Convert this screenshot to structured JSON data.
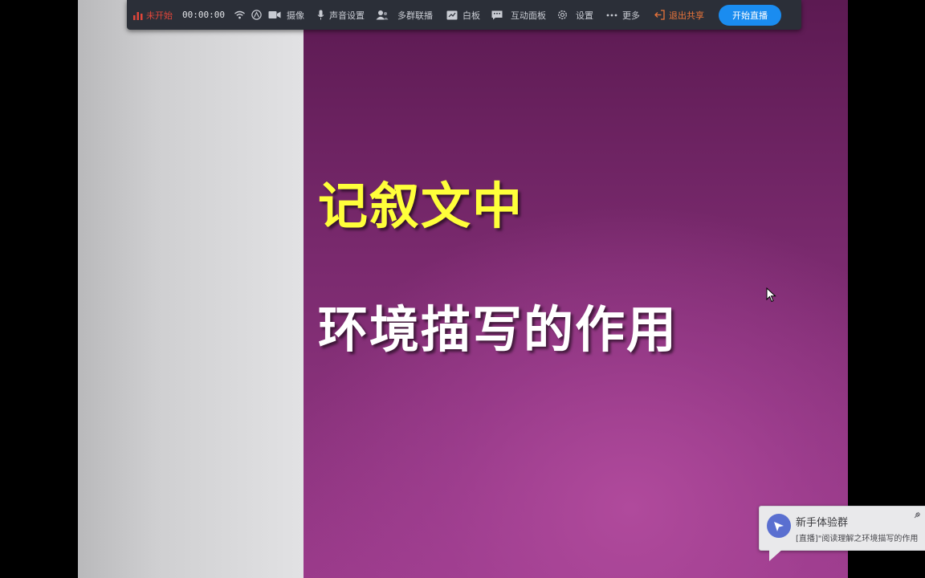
{
  "toolbar": {
    "status_label": "未开始",
    "timer": "00:00:00",
    "camera_label": "摄像",
    "audio_label": "声音设置",
    "multi_stream_label": "多群联播",
    "whiteboard_label": "白板",
    "interactive_label": "互动面板",
    "settings_label": "设置",
    "more_label": "更多",
    "exit_share_label": "退出共享",
    "start_live_label": "开始直播"
  },
  "slide": {
    "title_line1": "记叙文中",
    "title_line2": "环境描写的作用"
  },
  "toast": {
    "title": "新手体验群",
    "message": "[直播]\"阅读理解之环境描写的作用"
  },
  "colors": {
    "toolbar_bg": "#2b2f38",
    "status_red": "#e0463a",
    "exit_orange": "#e9743a",
    "start_button_blue": "#1a8cf0",
    "slide_title1_yellow": "#ffff3a",
    "slide_title2_white": "#ffffff",
    "slide_purple": "#7a2a6e"
  }
}
